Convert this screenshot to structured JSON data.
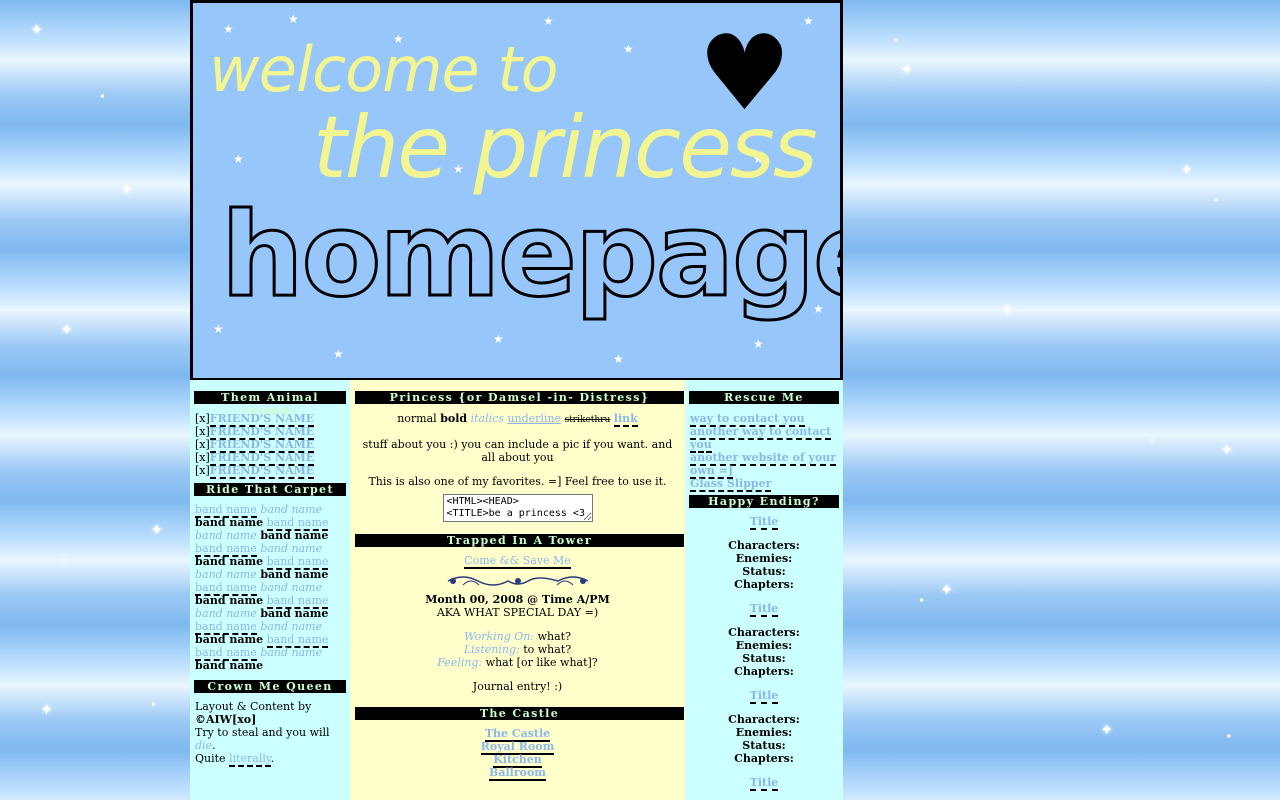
{
  "banner": {
    "line1": "welcome to",
    "line2": "the princess",
    "line3": "homepage!"
  },
  "left": {
    "friends": {
      "title": "Them Animal Friends",
      "prefix": "[x]",
      "items": [
        "FRIEND'S NAME",
        "FRIEND'S NAME",
        "FRIEND'S NAME",
        "FRIEND'S NAME",
        "FRIEND'S NAME"
      ]
    },
    "carpet": {
      "title": "Ride That Carpet",
      "band": "band name"
    },
    "credits": {
      "title": "Crown Me Queen",
      "line1": "Layout & Content by",
      "author": "©AIW[xo]",
      "line3a": "Try to steal and you will ",
      "die": "die",
      "line3b": ".",
      "line4a": "Quite ",
      "literally": "literally",
      "line4b": "."
    }
  },
  "center": {
    "princess": {
      "title": "Princess {or Damsel -in- Distress}",
      "normal": "normal",
      "bold": "bold",
      "italics": "italics",
      "underline": "underline",
      "strike": "strikethru",
      "link": "link",
      "about": "stuff about you :) you can include a pic if you want. and all about you",
      "favorite": "This is also one of my favorites. =] Feel free to use it.",
      "code": "<HTML><HEAD>\n<TITLE>be a princess <3"
    },
    "tower": {
      "title": "Trapped In A Tower",
      "save_link": "Come && Save Me",
      "date": "Month 00, 2008 @ Time A/PM",
      "aka": "AKA WHAT SPECIAL DAY =)",
      "working_label": "Working On:",
      "working_value": " what?",
      "listening_label": "Listening:",
      "listening_value": " to what?",
      "feeling_label": "Feeling:",
      "feeling_value": " what [or like what]?",
      "entry": "Journal entry! :)"
    },
    "castle": {
      "title": "The Castle",
      "links": [
        "The Castle",
        "Royal Room",
        "Kitchen",
        "Ballroom"
      ]
    }
  },
  "right": {
    "rescue": {
      "title": "Rescue Me",
      "links": [
        "way to contact you",
        "another way to contact you",
        "another website of your own =]",
        "Glass Slipper"
      ]
    },
    "ending": {
      "title": "Happy Ending?",
      "entry_title": "Title",
      "characters": "Characters:",
      "enemies": "Enemies:",
      "status": "Status:",
      "chapters": "Chapters:"
    }
  },
  "colors": {
    "banner_bg": "#97c6fb",
    "side_bg": "#ccffff",
    "center_bg": "#ffffcc",
    "link": "#8ab8e8",
    "heading_text": "#ccffcc"
  }
}
